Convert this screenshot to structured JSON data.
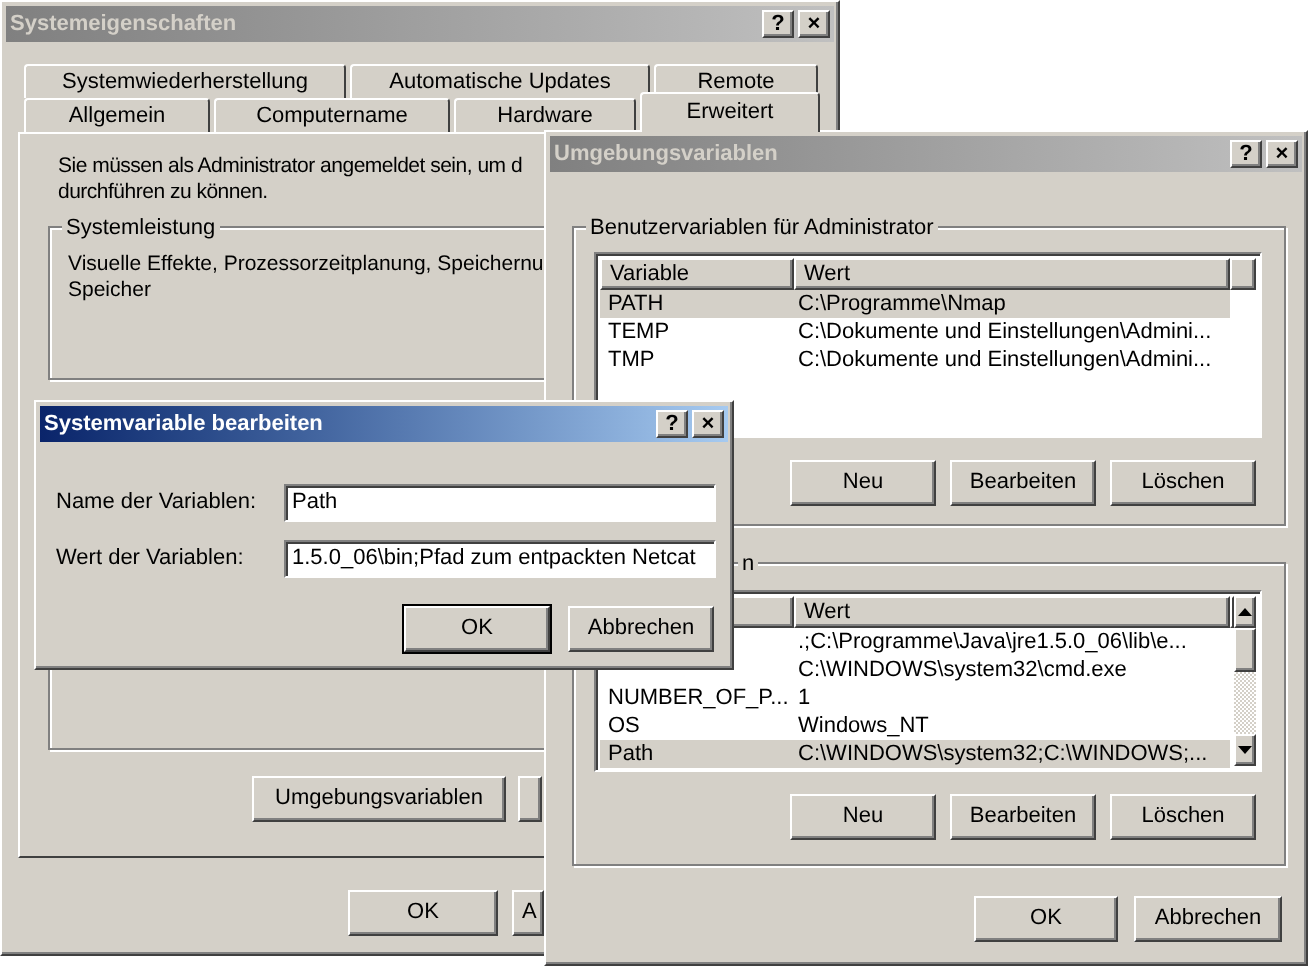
{
  "system_properties": {
    "title": "Systemeigenschaften",
    "active": false,
    "title_buttons": [
      "?",
      "×"
    ],
    "tab_rows": [
      [
        {
          "label": "Systemwiederherstellung",
          "selected": false
        },
        {
          "label": "Automatische Updates",
          "selected": false
        },
        {
          "label": "Remote",
          "selected": false
        }
      ],
      [
        {
          "label": "Allgemein",
          "selected": false
        },
        {
          "label": "Computername",
          "selected": false
        },
        {
          "label": "Hardware",
          "selected": false
        },
        {
          "label": "Erweitert",
          "selected": true
        }
      ]
    ],
    "notice": [
      "Sie müssen als Administrator angemeldet sein, um d",
      "durchführen zu können."
    ],
    "group": {
      "title": "Systemleistung",
      "text": [
        "Visuelle Effekte, Prozessorzeitplanung, Speichernu",
        "Speicher"
      ]
    },
    "panel_button": "Umgebungsvariablen",
    "buttons": [
      "OK",
      "A"
    ]
  },
  "environment_variables": {
    "title": "Umgebungsvariablen",
    "active": false,
    "title_buttons": [
      "?",
      "×"
    ],
    "user_group": {
      "title": "Benutzervariablen für Administrator",
      "columns": [
        "Variable",
        "Wert"
      ],
      "rows": [
        {
          "variable": "PATH",
          "value": "C:\\Programme\\Nmap",
          "selected": true
        },
        {
          "variable": "TEMP",
          "value": "C:\\Dokumente und Einstellungen\\Admini...",
          "selected": false
        },
        {
          "variable": "TMP",
          "value": "C:\\Dokumente und Einstellungen\\Admini...",
          "selected": false
        }
      ],
      "buttons": [
        "Neu",
        "Bearbeiten",
        "Löschen"
      ]
    },
    "system_group": {
      "title": "n",
      "columns": [
        "Wert"
      ],
      "rows": [
        {
          "value": ".;C:\\Programme\\Java\\jre1.5.0_06\\lib\\e...",
          "selected": false
        },
        {
          "value": "C:\\WINDOWS\\system32\\cmd.exe",
          "selected": false
        },
        {
          "variable": "NUMBER_OF_P...",
          "value": "1",
          "selected": false
        },
        {
          "variable": "OS",
          "value": "Windows_NT",
          "selected": false
        },
        {
          "variable": "Path",
          "value": "C:\\WINDOWS\\system32;C:\\WINDOWS;...",
          "selected": true
        }
      ],
      "buttons": [
        "Neu",
        "Bearbeiten",
        "Löschen"
      ]
    },
    "buttons": [
      "OK",
      "Abbrechen"
    ]
  },
  "edit_dialog": {
    "title": "Systemvariable bearbeiten",
    "active": true,
    "title_buttons": [
      "?",
      "×"
    ],
    "fields": [
      {
        "label": "Name der Variablen:",
        "value": "Path"
      },
      {
        "label": "Wert der Variablen:",
        "value": "1.5.0_06\\bin;Pfad zum entpackten Netcat"
      }
    ],
    "buttons": [
      {
        "label": "OK",
        "default": true
      },
      {
        "label": "Abbrechen",
        "default": false
      }
    ]
  }
}
